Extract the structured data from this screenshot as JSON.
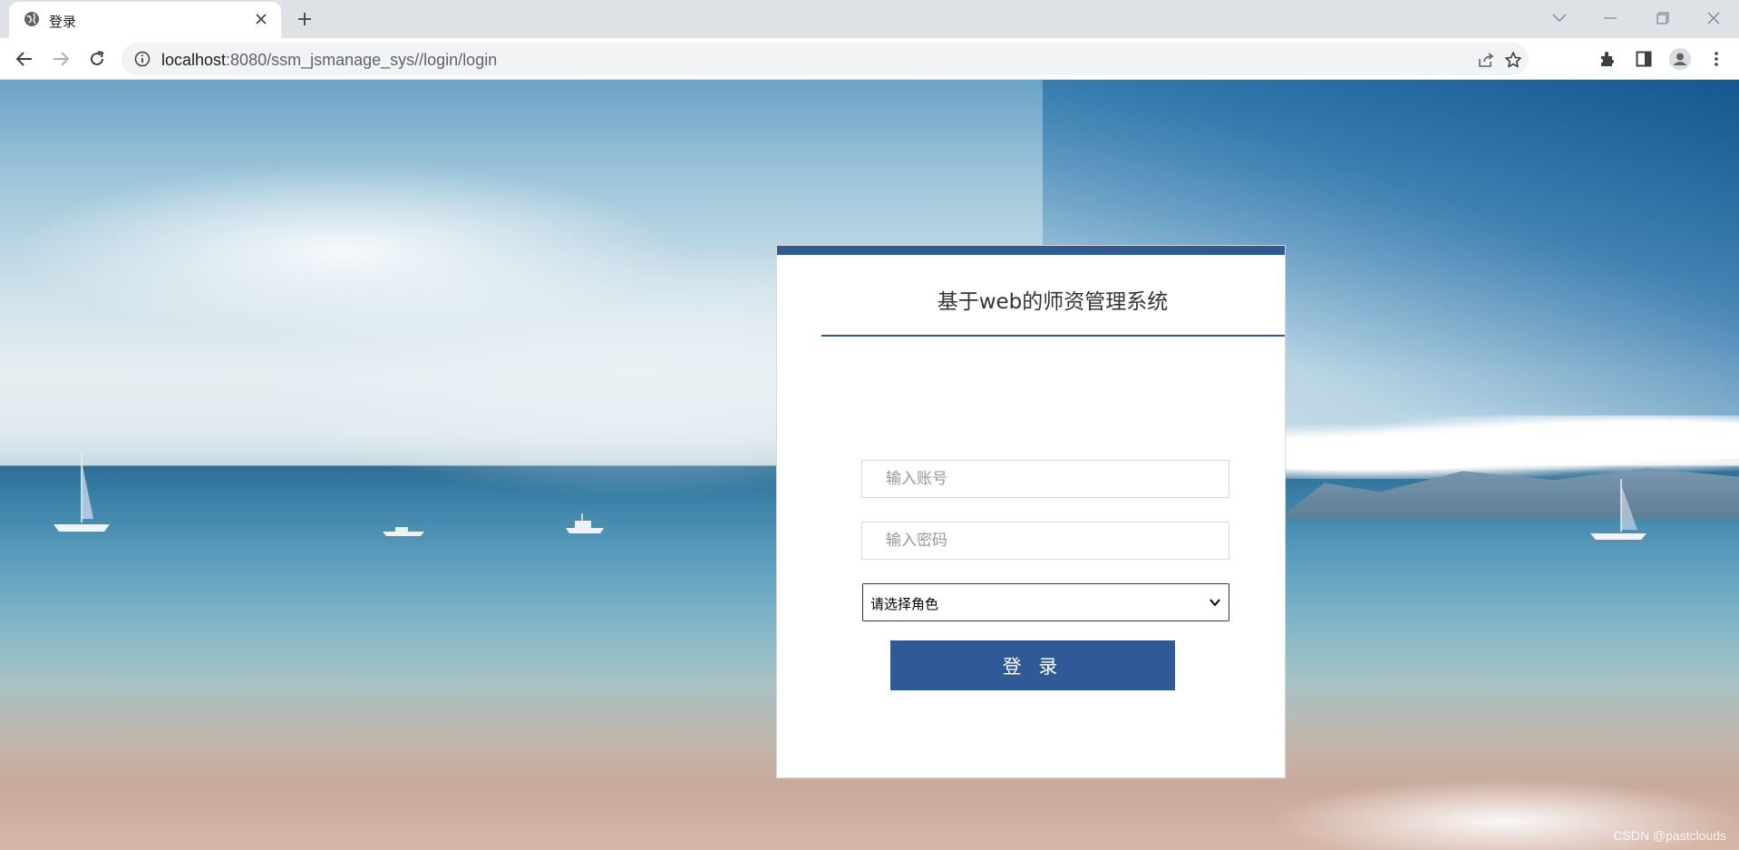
{
  "browser": {
    "tab": {
      "title": "登录",
      "favicon": "globe-icon",
      "close_icon": "close-icon"
    },
    "new_tab_icon": "plus-icon",
    "window_controls": [
      "chevron-down-icon",
      "minimize-icon",
      "restore-icon",
      "close-icon"
    ],
    "nav": [
      "back-icon",
      "forward-icon",
      "reload-icon"
    ],
    "address": {
      "host": "localhost",
      "path": ":8080/ssm_jsmanage_sys//login/login",
      "info_icon": "info-icon"
    },
    "omnibox_actions": [
      "share-icon",
      "star-icon"
    ],
    "toolbar_actions": [
      "extensions-icon",
      "side-panel-icon",
      "profile-icon",
      "menu-icon"
    ]
  },
  "login": {
    "title": "基于web的师资管理系统",
    "account_placeholder": "输入账号",
    "password_placeholder": "输入密码",
    "role_select": {
      "selected": "请选择角色"
    },
    "submit_label": "登 录"
  },
  "colors": {
    "accent": "#2f5a96",
    "tabstrip": "#dee1e6"
  },
  "watermark": "CSDN @pastclouds"
}
